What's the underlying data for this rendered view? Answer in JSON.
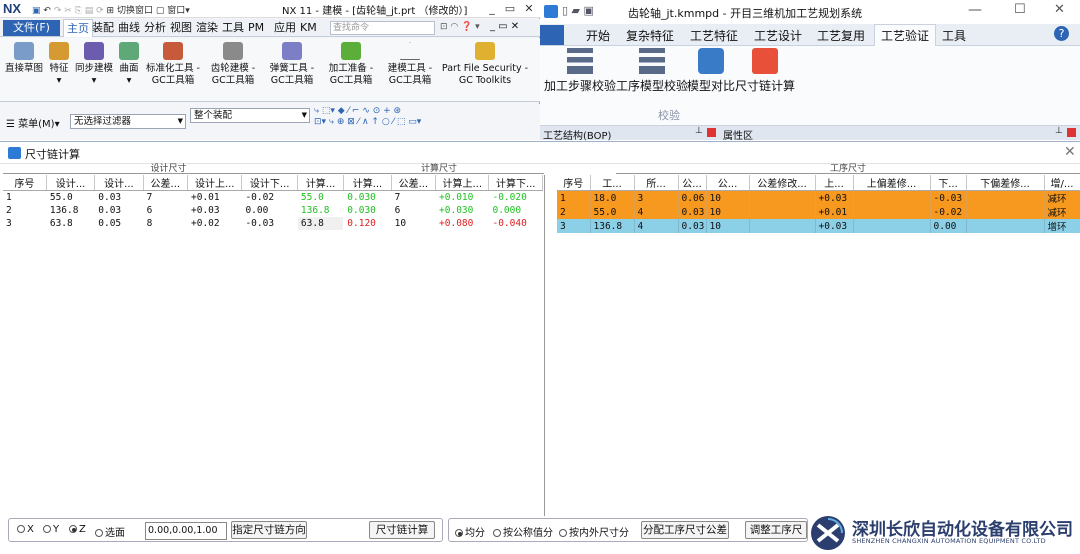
{
  "nx": {
    "logo": "NX",
    "quick_switch": "切换窗口",
    "quick_window": "窗口",
    "window_title": "NX 11 - 建模 - [齿轮轴_jt.prt （修改的）]",
    "file_tab": "文件(F)",
    "tabs": [
      "主页",
      "装配",
      "曲线",
      "分析",
      "视图",
      "渲染",
      "工具",
      "PM",
      "应用",
      "KM"
    ],
    "search_placeholder": "查找命令",
    "ribbon": [
      {
        "l1": "直接草图",
        "l2": ""
      },
      {
        "l1": "特征",
        "l2": ""
      },
      {
        "l1": "同步建模",
        "l2": ""
      },
      {
        "l1": "曲面",
        "l2": ""
      },
      {
        "l1": "标准化工具 -",
        "l2": "GC工具箱"
      },
      {
        "l1": "齿轮建模 -",
        "l2": "GC工具箱"
      },
      {
        "l1": "弹簧工具 -",
        "l2": "GC工具箱"
      },
      {
        "l1": "加工准备 -",
        "l2": "GC工具箱"
      },
      {
        "l1": "建模工具 -",
        "l2": "GC工具箱"
      },
      {
        "l1": "Part File Security -",
        "l2": "GC Toolkits"
      }
    ],
    "menu_label": "菜单(M)",
    "filter_value": "无选择过滤器",
    "assembly_value": "整个装配"
  },
  "km": {
    "window_title": "齿轮轴_jt.kmmpd - 开目三维机加工艺规划系统",
    "tabs": [
      "开始",
      "复杂特征",
      "工艺特征",
      "工艺设计",
      "工艺复用",
      "工艺验证",
      "工具"
    ],
    "active_tab": "工艺验证",
    "ribbon_buttons": [
      "加工步骤校验",
      "工序模型校验",
      "模型对比",
      "尺寸链计算"
    ],
    "group_label": "校验",
    "panel_left": "工艺结构(BOP)",
    "panel_right": "属性区"
  },
  "dialog": {
    "title": "尺寸链计算",
    "group_design": "设计尺寸",
    "group_calc": "计算尺寸",
    "group_process": "工序尺寸",
    "left_headers": [
      "序号",
      "设计...",
      "设计...",
      "公差...",
      "设计上...",
      "设计下...",
      "计算...",
      "计算...",
      "公差...",
      "计算上...",
      "计算下..."
    ],
    "left_rows": [
      [
        "1",
        "55.0",
        "0.03",
        "7",
        "+0.01",
        "-0.02",
        "55.0",
        "0.030",
        "7",
        "+0.010",
        "-0.020"
      ],
      [
        "2",
        "136.8",
        "0.03",
        "6",
        "+0.03",
        "0.00",
        "136.8",
        "0.030",
        "6",
        "+0.030",
        "0.000"
      ],
      [
        "3",
        "63.8",
        "0.05",
        "8",
        "+0.02",
        "-0.03",
        "63.8",
        "0.120",
        "10",
        "+0.080",
        "-0.040"
      ]
    ],
    "right_headers": [
      "序号",
      "工...",
      "所...",
      "公...",
      "公...",
      "公差修改...",
      "上...",
      "上偏差修...",
      "下...",
      "下偏差修...",
      "增/..."
    ],
    "right_rows": [
      [
        "1",
        "18.0",
        "3",
        "0.06",
        "10",
        "",
        "+0.03",
        "",
        "-0.03",
        "",
        "减环"
      ],
      [
        "2",
        "55.0",
        "4",
        "0.03",
        "10",
        "",
        "+0.01",
        "",
        "-0.02",
        "",
        "减环"
      ],
      [
        "3",
        "136.8",
        "4",
        "0.03",
        "10",
        "",
        "+0.03",
        "",
        "0.00",
        "",
        "增环"
      ]
    ],
    "axis_x": "X",
    "axis_y": "Y",
    "axis_z": "Z",
    "axis_select": "选面",
    "coord_value": "0.00,0.00,1.00",
    "btn_direction": "指定尺寸链方向",
    "btn_calc": "尺寸链计算",
    "opt_equal": "均分",
    "opt_nominal": "按公称值分",
    "opt_tolerance": "按内外尺寸分",
    "btn_allocate": "分配工序尺寸公差",
    "btn_adjust": "调整工序尺"
  },
  "logo": {
    "cn": "深圳长欣自动化设备有限公司",
    "en": "SHENZHEN CHANGXIN AUTOMATION EQUIPMENT CO.LTD"
  },
  "colors": {
    "orange_row": "#f7991f",
    "blue_row": "#8cd0e8",
    "green_text": "#21c021",
    "red_text": "#e02020",
    "nx_blue": "#2e64b4"
  }
}
